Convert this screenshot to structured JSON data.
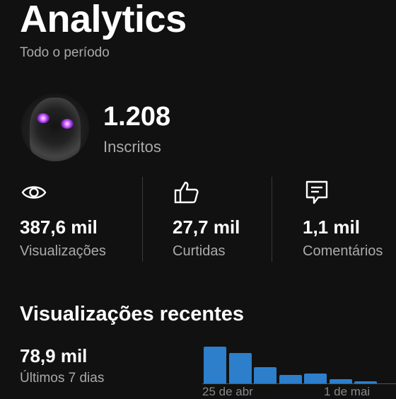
{
  "header": {
    "title": "Analytics",
    "period": "Todo o período"
  },
  "channel": {
    "subscriber_count": "1.208",
    "subscriber_label": "Inscritos"
  },
  "stats": [
    {
      "icon": "eye-icon",
      "value": "387,6 mil",
      "label": "Visualizações"
    },
    {
      "icon": "thumbs-up-icon",
      "value": "27,7 mil",
      "label": "Curtidas"
    },
    {
      "icon": "comment-icon",
      "value": "1,1 mil",
      "label": "Comentários"
    }
  ],
  "recent": {
    "title": "Visualizações recentes",
    "value": "78,9 mil",
    "period_label": "Últimos 7 dias"
  },
  "chart_data": {
    "type": "bar",
    "categories": [
      "25 de abr",
      "",
      "",
      "",
      "",
      "1 de mai",
      ""
    ],
    "tick_labels": [
      "25 de abr",
      "1 de mai"
    ],
    "values": [
      22.5,
      18.5,
      10.0,
      5.0,
      6.0,
      2.5,
      1.5
    ],
    "bar_color": "#2d7fcb"
  },
  "colors": {
    "background": "#111111",
    "text_primary": "#ffffff",
    "text_secondary": "#aaaaaa",
    "accent": "#2d7fcb"
  }
}
